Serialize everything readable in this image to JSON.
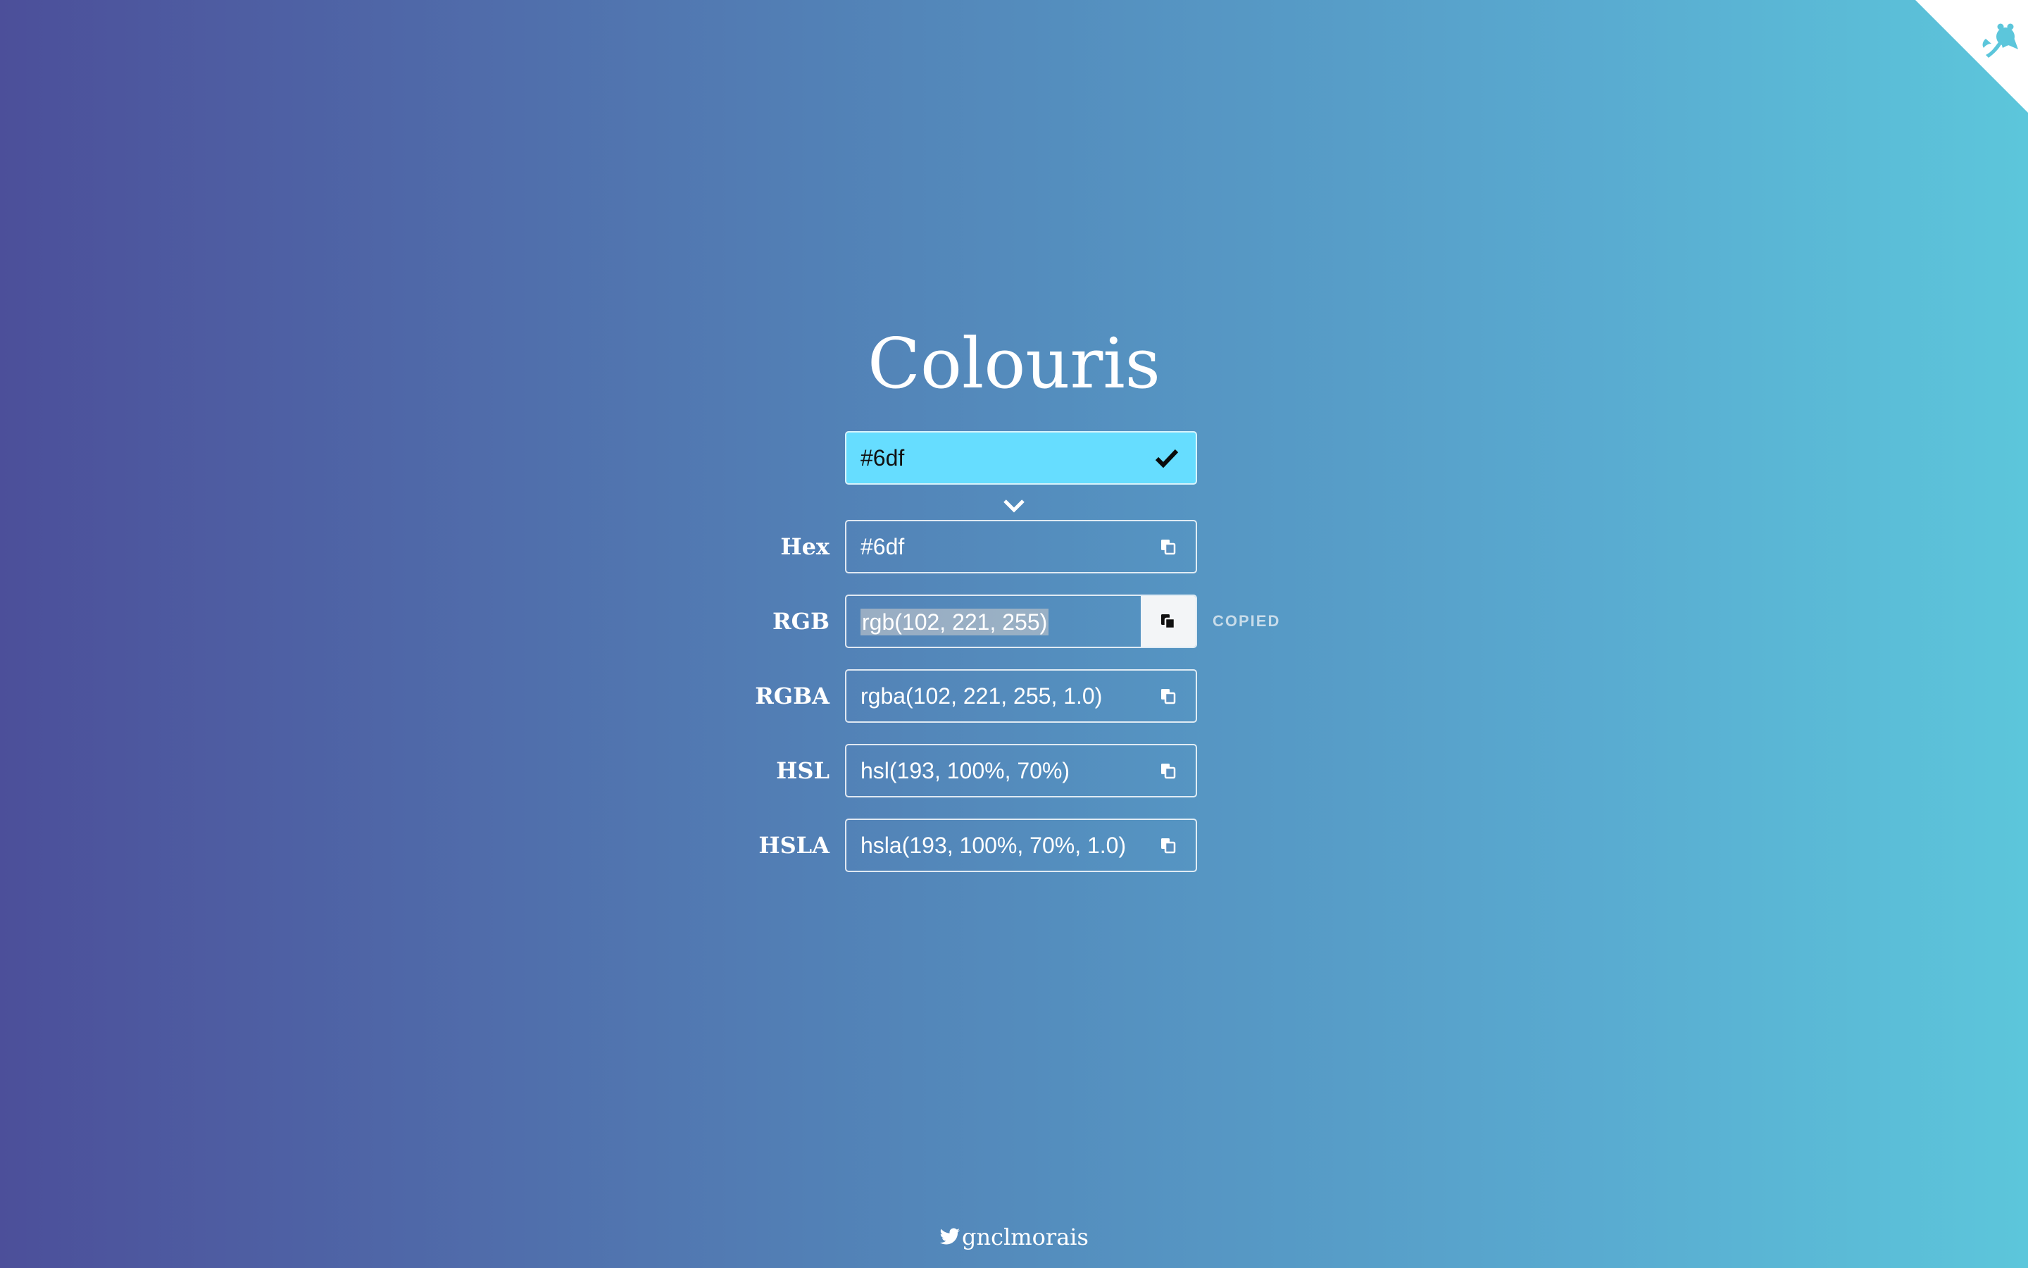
{
  "app": {
    "title": "Colouris"
  },
  "picker": {
    "value": "#6df",
    "swatch_color": "#66ddff",
    "confirm_icon": "check-icon"
  },
  "formats": [
    {
      "label": "Hex",
      "value": "#6df",
      "copy_icon": "copy-icon"
    },
    {
      "label": "RGB",
      "value": "rgb(102, 221, 255)",
      "copy_icon": "copy-icon",
      "status": "COPIED",
      "selected": true
    },
    {
      "label": "RGBA",
      "value": "rgba(102, 221, 255, 1.0)",
      "copy_icon": "copy-icon"
    },
    {
      "label": "HSL",
      "value": "hsl(193, 100%, 70%)",
      "copy_icon": "copy-icon"
    },
    {
      "label": "HSLA",
      "value": "hsla(193, 100%, 70%, 1.0)",
      "copy_icon": "copy-icon"
    }
  ],
  "footer": {
    "handle": "gnclmorais",
    "icon": "twitter-icon"
  },
  "corner": {
    "icon": "github-octocat-icon"
  }
}
